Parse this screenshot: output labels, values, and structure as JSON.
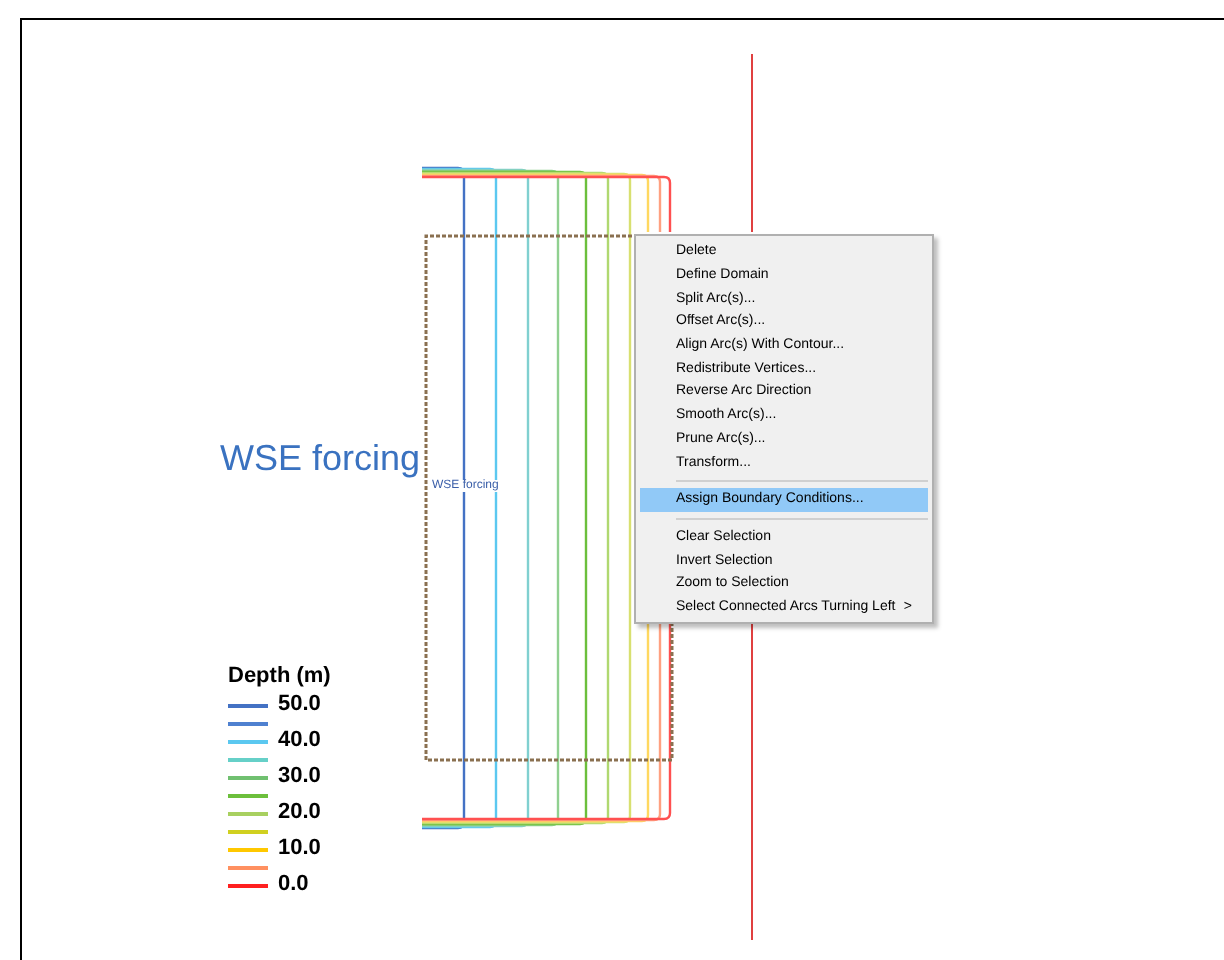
{
  "canvas": {
    "label": "WSE forcing",
    "arc_label": "WSE forcing"
  },
  "legend": {
    "title": "Depth (m)",
    "entries": [
      {
        "color": "#4472c4",
        "label": "50.0"
      },
      {
        "color": "#4f81d0"
      },
      {
        "color": "#5bc8f0",
        "label": "40.0"
      },
      {
        "color": "#66d0c8"
      },
      {
        "color": "#70c070",
        "label": "30.0"
      },
      {
        "color": "#6cbf3c"
      },
      {
        "color": "#a8d060",
        "label": "20.0"
      },
      {
        "color": "#d0d020"
      },
      {
        "color": "#ffc800",
        "label": "10.0"
      },
      {
        "color": "#ff9060"
      },
      {
        "color": "#ff2020",
        "label": "0.0"
      }
    ]
  },
  "context_menu": {
    "items": [
      {
        "kind": "item",
        "label": "Delete",
        "selected": false
      },
      {
        "kind": "item",
        "label": "Define Domain",
        "selected": false
      },
      {
        "kind": "item",
        "label": "Split Arc(s)...",
        "selected": false
      },
      {
        "kind": "item",
        "label": "Offset Arc(s)...",
        "selected": false
      },
      {
        "kind": "item",
        "label": "Align Arc(s) With Contour...",
        "selected": false
      },
      {
        "kind": "item",
        "label": "Redistribute Vertices...",
        "selected": false
      },
      {
        "kind": "item",
        "label": "Reverse Arc Direction",
        "selected": false
      },
      {
        "kind": "item",
        "label": "Smooth Arc(s)...",
        "selected": false
      },
      {
        "kind": "item",
        "label": "Prune Arc(s)...",
        "selected": false
      },
      {
        "kind": "item",
        "label": "Transform...",
        "selected": false
      },
      {
        "kind": "separator"
      },
      {
        "kind": "item",
        "label": "Assign Boundary Conditions...",
        "selected": true
      },
      {
        "kind": "separator"
      },
      {
        "kind": "item",
        "label": "Clear Selection",
        "selected": false
      },
      {
        "kind": "item",
        "label": "Invert Selection",
        "selected": false
      },
      {
        "kind": "item",
        "label": "Zoom to Selection",
        "selected": false
      },
      {
        "kind": "item",
        "label": "Select Connected Arcs Turning Left",
        "selected": false,
        "submenu_arrow": ">"
      }
    ]
  }
}
